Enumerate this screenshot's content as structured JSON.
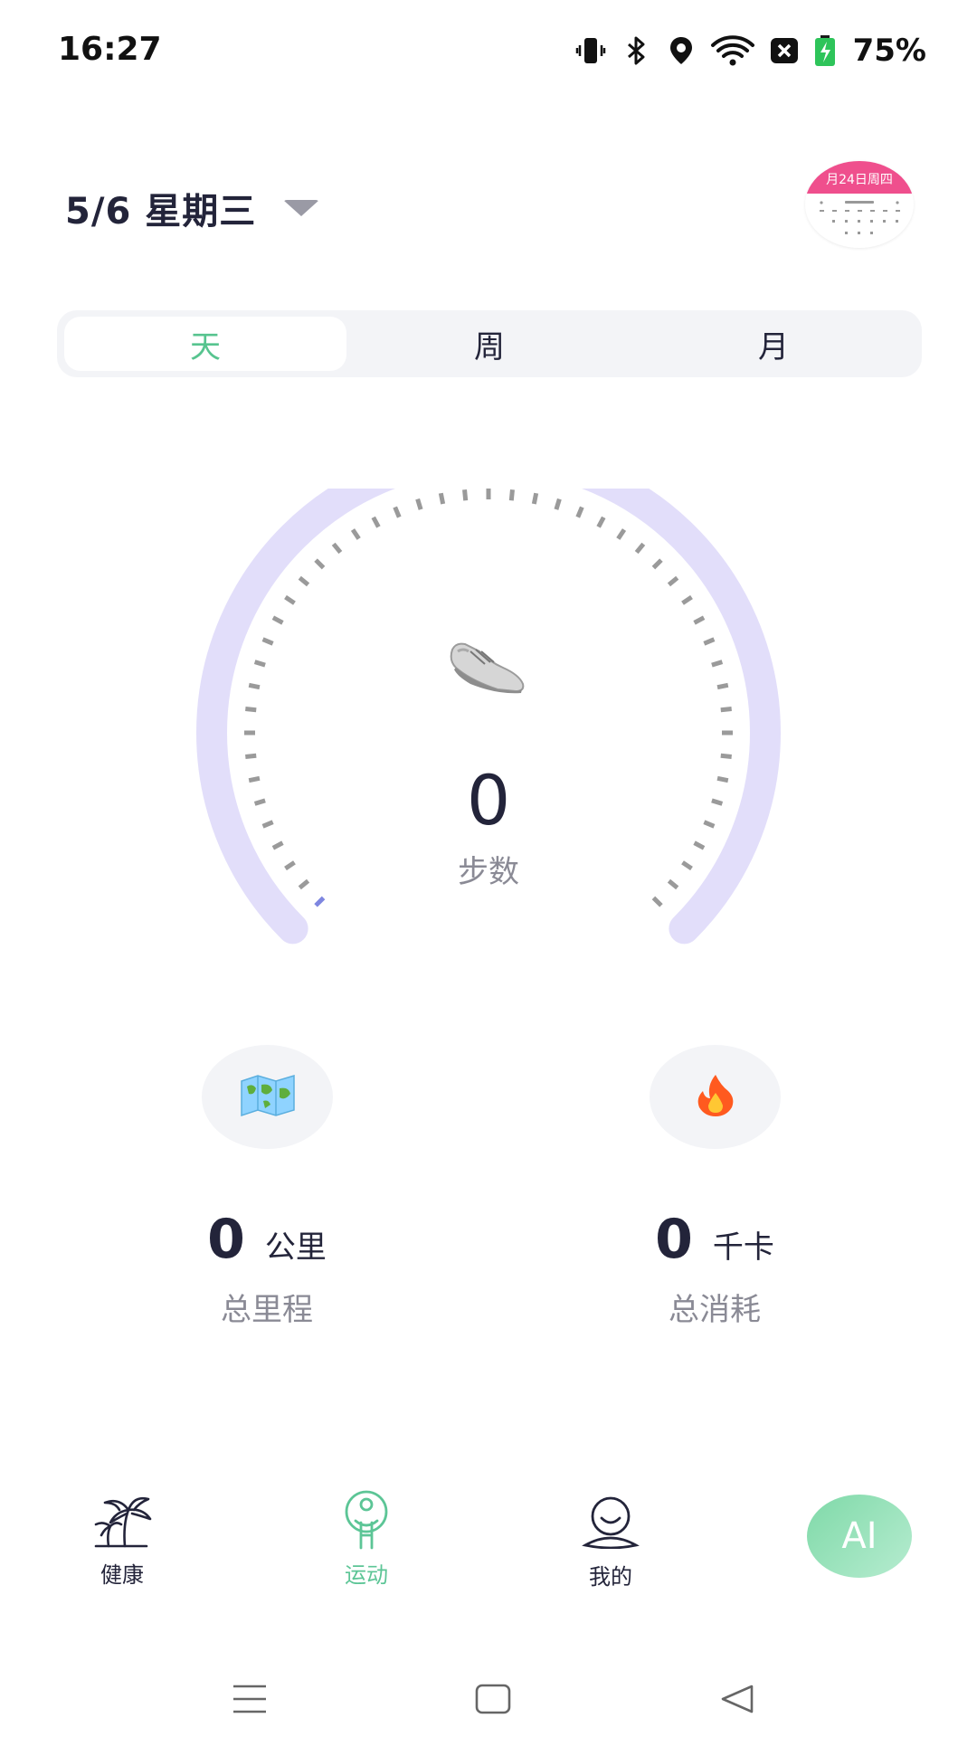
{
  "status_bar": {
    "time": "16:27",
    "battery": "75%",
    "icons": [
      "vibrate-icon",
      "bluetooth-icon",
      "location-icon",
      "wifi-icon",
      "notification-x-icon",
      "battery-charging-icon"
    ]
  },
  "header": {
    "date": "5/6 星期三",
    "calendar_thumb_text": "月24日周四"
  },
  "tabs": [
    {
      "label": "天",
      "active": true
    },
    {
      "label": "周",
      "active": false
    },
    {
      "label": "月",
      "active": false
    }
  ],
  "steps": {
    "value": "0",
    "label": "步数",
    "progress": 0,
    "icon": "shoe-icon"
  },
  "stats": {
    "distance": {
      "value": "0",
      "unit": "公里",
      "label": "总里程",
      "icon": "map-icon"
    },
    "calories": {
      "value": "0",
      "unit": "千卡",
      "label": "总消耗",
      "icon": "fire-icon"
    }
  },
  "bottom_nav": {
    "items": [
      {
        "label": "健康",
        "icon": "palm-tree-icon",
        "active": false
      },
      {
        "label": "运动",
        "icon": "person-icon",
        "active": true
      },
      {
        "label": "我的",
        "icon": "profile-face-icon",
        "active": false
      }
    ],
    "ai_label": "AI"
  },
  "colors": {
    "accent_green": "#57c48f",
    "gauge_track": "#e2defa",
    "tick": "#9a9a9a",
    "text_dark": "#23243a",
    "text_muted": "#8a8a95"
  }
}
